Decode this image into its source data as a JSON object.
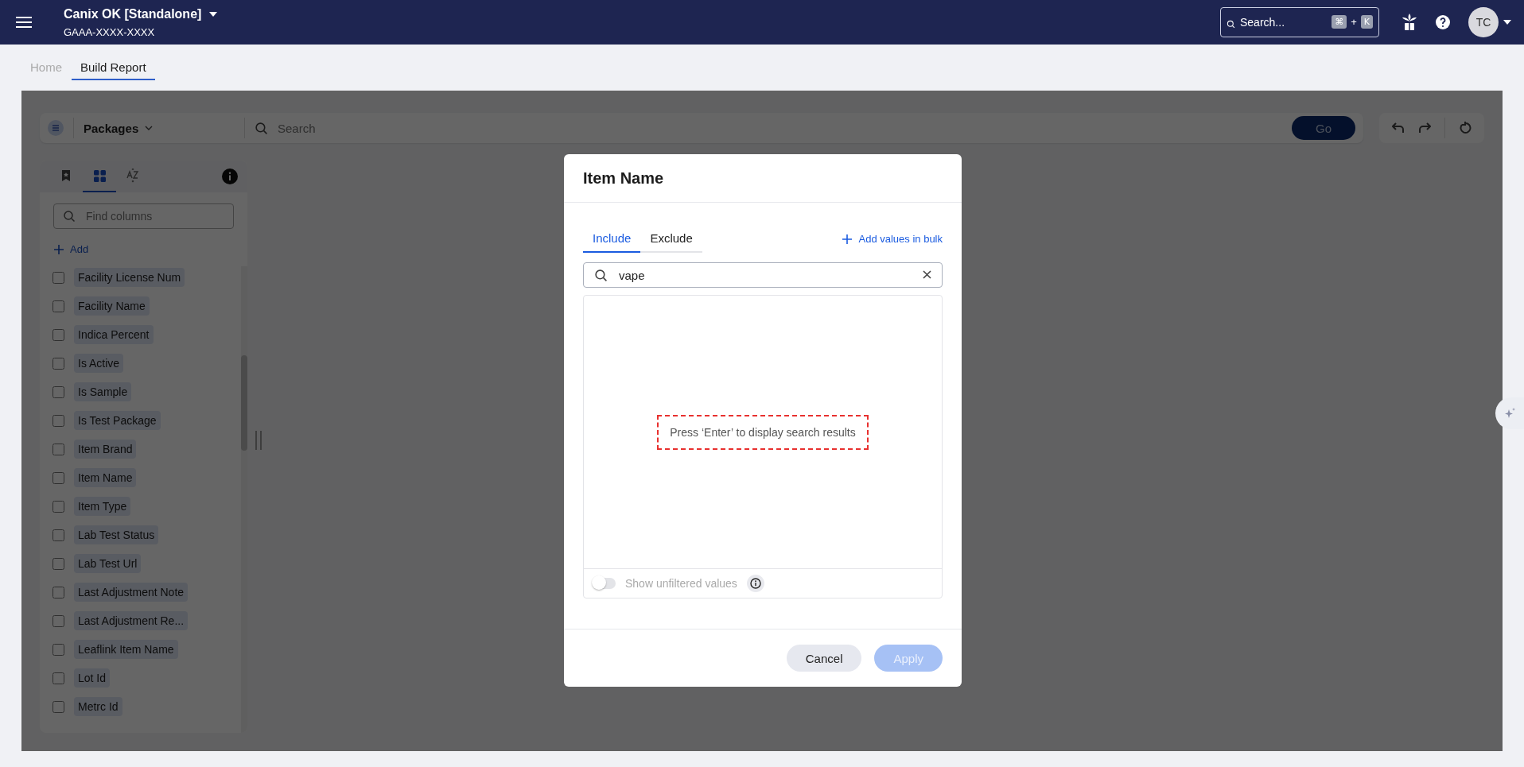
{
  "app_bar": {
    "org_name": "Canix OK [Standalone]",
    "org_id": "GAAA-XXXX-XXXX",
    "search": {
      "placeholder": "Search..."
    },
    "shortcut_keys": [
      "⌘",
      "K"
    ],
    "shortcut_joiner": "+",
    "avatar": "TC"
  },
  "breadcrumbs": [
    {
      "label": "Home",
      "selected": false
    },
    {
      "label": "Build Report",
      "selected": true
    }
  ],
  "toolbar": {
    "source": "Packages",
    "search": {
      "placeholder": "Search"
    },
    "go_button": "Go"
  },
  "column_panel": {
    "tabs": [
      {
        "kind": "bookmark",
        "selected": false
      },
      {
        "kind": "grid",
        "selected": true
      },
      {
        "kind": "az",
        "selected": false
      }
    ],
    "find": {
      "placeholder": "Find columns"
    },
    "add_label": "Add",
    "columns": [
      {
        "label": "Facility License Num",
        "checked": false
      },
      {
        "label": "Facility Name",
        "checked": false
      },
      {
        "label": "Indica Percent",
        "checked": false
      },
      {
        "label": "Is Active",
        "checked": false
      },
      {
        "label": "Is Sample",
        "checked": false
      },
      {
        "label": "Is Test Package",
        "checked": false
      },
      {
        "label": "Item Brand",
        "checked": false
      },
      {
        "label": "Item Name",
        "checked": false
      },
      {
        "label": "Item Type",
        "checked": false
      },
      {
        "label": "Lab Test Status",
        "checked": false
      },
      {
        "label": "Lab Test Url",
        "checked": false
      },
      {
        "label": "Last Adjustment Note",
        "checked": false
      },
      {
        "label": "Last Adjustment Re...",
        "checked": false
      },
      {
        "label": "Leaflink Item Name",
        "checked": false
      },
      {
        "label": "Lot Id",
        "checked": false
      },
      {
        "label": "Metrc Id",
        "checked": false
      }
    ]
  },
  "dialog": {
    "title": "Item Name",
    "tabs": [
      {
        "label": "Include",
        "selected": true
      },
      {
        "label": "Exclude",
        "selected": false
      }
    ],
    "bulk_link": "Add values in bulk",
    "search": {
      "value": "vape"
    },
    "hint": "Press ‘Enter’ to display search results",
    "toggle": {
      "label": "Show unfiltered values",
      "on": false
    },
    "buttons": [
      {
        "label": "Cancel",
        "kind": "secondary",
        "disabled": false
      },
      {
        "label": "Apply",
        "kind": "primary",
        "disabled": true
      }
    ]
  }
}
